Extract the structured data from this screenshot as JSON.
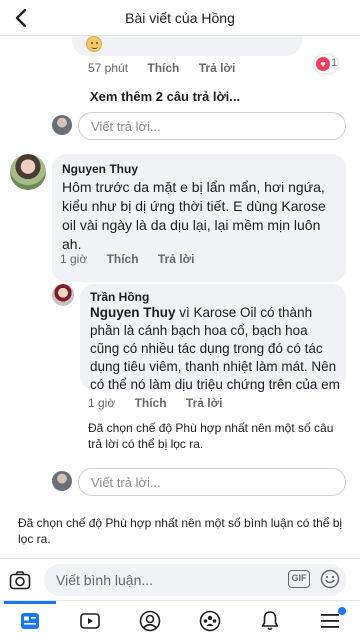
{
  "header": {
    "title": "Bài viết của Hồng"
  },
  "comment_top": {
    "time": "57 phút",
    "like_label": "Thích",
    "reply_label": "Trả lời",
    "reaction_count": "1"
  },
  "see_more_replies": "Xem thêm 2 câu trả lời...",
  "reply_placeholder": "Viết trả lời...",
  "comment_main": {
    "author": "Nguyen Thuy",
    "text": "Hôm trước da mặt e bị lẩn mẩn, hơi ngứa, kiểu như bị dị ứng thời tiết. E dùng Karose oil vài ngày là da dịu lại, lại mềm mịn luôn ah.",
    "time": "1 giờ",
    "like_label": "Thích",
    "reply_label": "Trả lời"
  },
  "reply": {
    "author": "Trần Hồng",
    "mention": "Nguyen Thuy",
    "text": " vì Karose Oil có thành phần là cánh bạch hoa cổ, bạch hoa cũng có nhiều tác dụng trong đó có tác dụng tiêu viêm, thanh nhiệt làm mát. Nên có thể nó làm dịu triệu chứng trên của em",
    "time": "1 giờ",
    "like_label": "Thích",
    "reply_label": "Trả lời"
  },
  "filter_notice_replies": "Đã chọn chế độ Phù hợp nhất nên một số câu trả lời có thể bị lọc ra.",
  "filter_notice_comments": "Đã chọn chế độ Phù hợp nhất nên một số bình luận có thể bị lọc ra.",
  "compose": {
    "placeholder": "Viết bình luận...",
    "gif_label": "GIF"
  },
  "colors": {
    "accent": "#1877f2",
    "reaction_red": "#f33e58",
    "muted": "#65676b",
    "bubble": "#f0f2f5"
  },
  "tabs": [
    "news-feed-icon",
    "watch-icon",
    "profile-icon",
    "groups-icon",
    "notifications-icon",
    "menu-icon"
  ]
}
